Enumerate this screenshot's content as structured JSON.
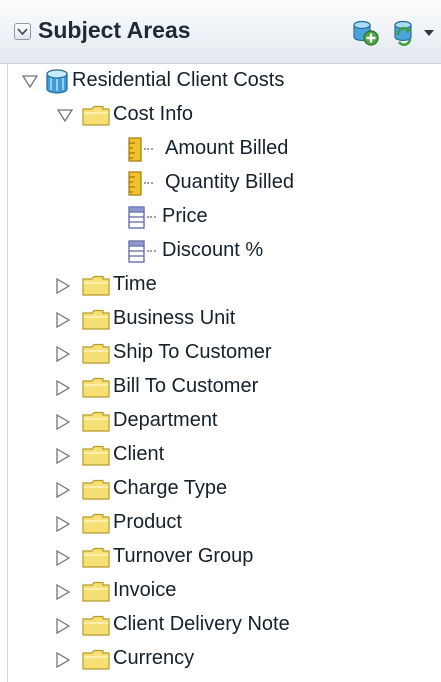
{
  "header": {
    "title": "Subject Areas",
    "icons": [
      "collapse-icon",
      "add-subject-area-icon",
      "refresh-icon",
      "dropdown-caret-icon"
    ]
  },
  "tree": {
    "root": {
      "label": "Residential Client Costs",
      "icon": "subject-area-icon",
      "expanded": true
    },
    "cost_info": {
      "label": "Cost Info",
      "icon": "folder-icon",
      "expanded": true,
      "columns": [
        {
          "label": "Amount Billed",
          "icon": "measure-ruler-icon"
        },
        {
          "label": "Quantity Billed",
          "icon": "measure-ruler-icon"
        },
        {
          "label": "Price",
          "icon": "attribute-column-icon"
        },
        {
          "label": "Discount %",
          "icon": "attribute-column-icon"
        }
      ]
    },
    "folders": [
      {
        "label": "Time"
      },
      {
        "label": "Business Unit"
      },
      {
        "label": "Ship To Customer"
      },
      {
        "label": "Bill To Customer"
      },
      {
        "label": "Department"
      },
      {
        "label": "Client"
      },
      {
        "label": "Charge Type"
      },
      {
        "label": "Product"
      },
      {
        "label": "Turnover Group"
      },
      {
        "label": "Invoice"
      },
      {
        "label": "Client Delivery Note"
      },
      {
        "label": "Currency"
      }
    ]
  },
  "colors": {
    "folder_fill": "#f6df74",
    "folder_stroke": "#b99a2c",
    "measure_fill": "#f2c12e",
    "column_stroke": "#5a67a8",
    "header_text": "#1e2a35"
  }
}
